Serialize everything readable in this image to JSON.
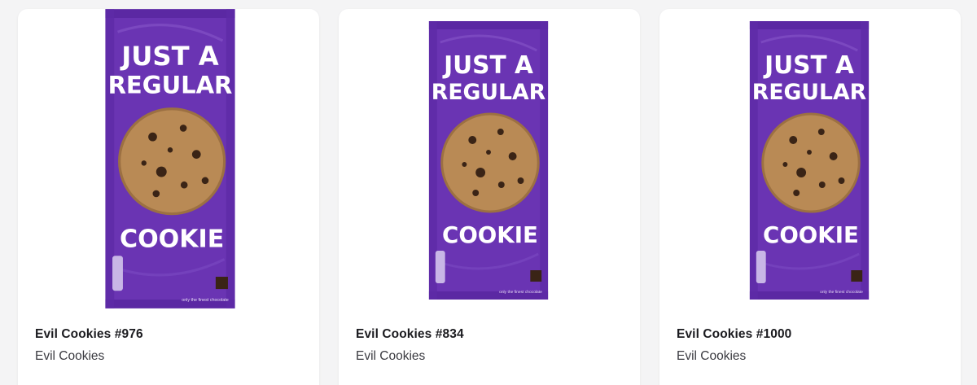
{
  "colors": {
    "pack_purple": "#6a34b3",
    "pack_dark": "#4f2296",
    "cookie": "#b98a55",
    "chip": "#3a2416",
    "card_bg": "#ffffff",
    "page_bg": "#f4f4f5"
  },
  "pack": {
    "line1": "JUST A",
    "line2": "REGULAR",
    "line3": "COOKIE",
    "footer_note": "only the finest chocolate"
  },
  "cards": [
    {
      "title": "Evil Cookies #976",
      "collection": "Evil Cookies",
      "image_icon": "cookie-pack-image"
    },
    {
      "title": "Evil Cookies #834",
      "collection": "Evil Cookies",
      "image_icon": "cookie-pack-image"
    },
    {
      "title": "Evil Cookies #1000",
      "collection": "Evil Cookies",
      "image_icon": "cookie-pack-image"
    }
  ]
}
